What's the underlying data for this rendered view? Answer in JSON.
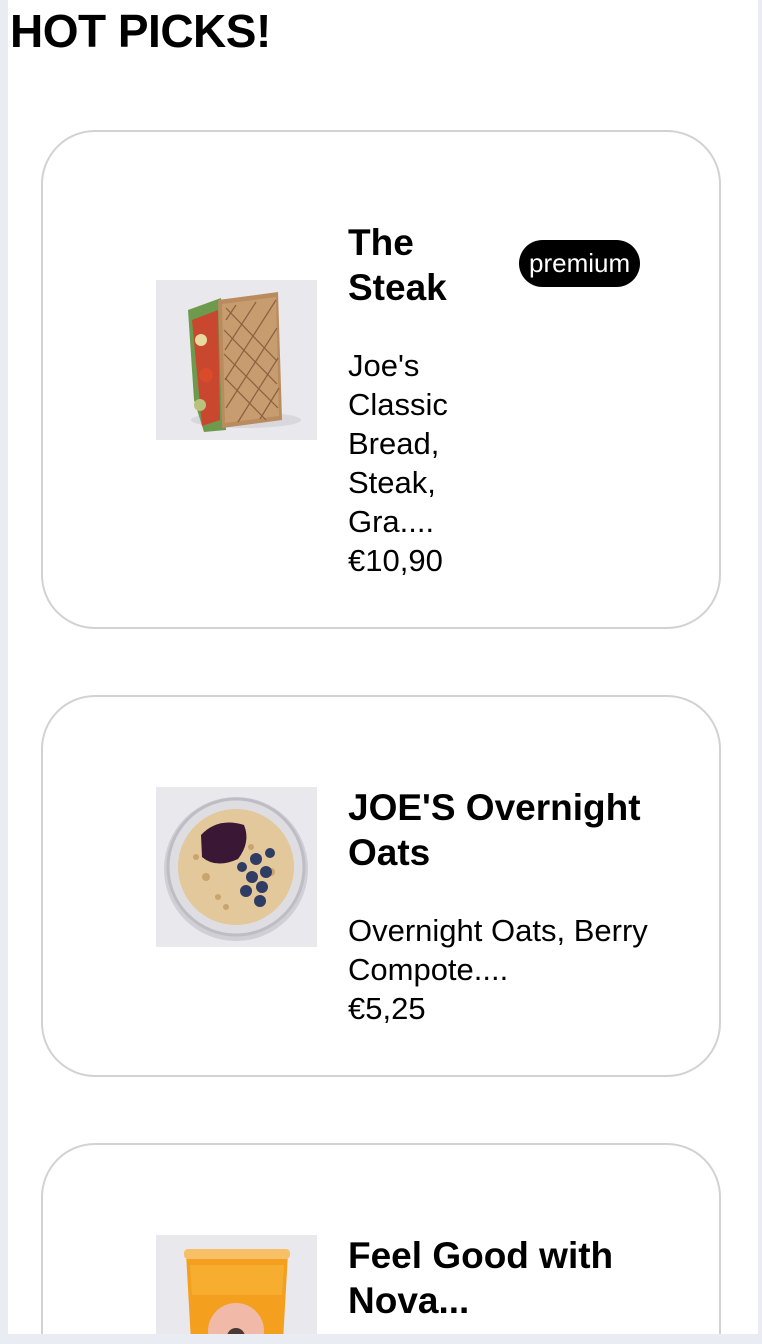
{
  "page": {
    "heading": "HOT PICKS!"
  },
  "products": [
    {
      "title": "The Steak",
      "badge": "premium",
      "description": "Joe's Classic Bread, Steak, Gra....",
      "price": "€10,90",
      "image_icon": "steak-sandwich-image"
    },
    {
      "title": "JOE'S Overnight Oats",
      "description": "Overnight Oats, Berry Compote....",
      "price": "€5,25",
      "image_icon": "overnight-oats-image"
    },
    {
      "title": "Feel Good with Nova...",
      "image_icon": "juice-cup-image"
    }
  ],
  "colors": {
    "card_border": "#d2d2d2",
    "badge_bg": "#000000",
    "badge_text": "#ffffff",
    "page_bg": "#ffffff",
    "frame_bg": "#e9ecf3"
  }
}
